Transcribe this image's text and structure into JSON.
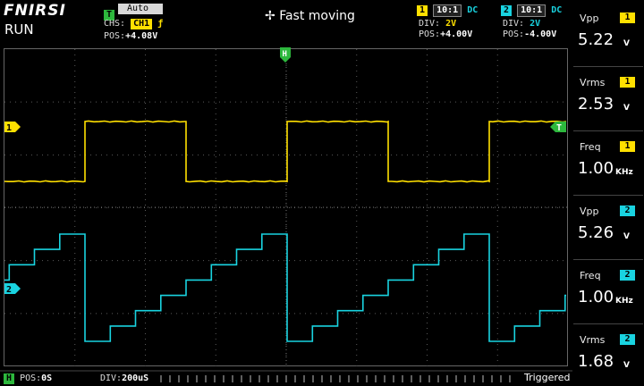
{
  "header": {
    "brand": "FNIRSI",
    "run_state": "RUN",
    "trigger_badge": "T",
    "trigger_mode": "Auto",
    "ch_select_label": "CHS:",
    "ch_select_value": "CH1",
    "edge_symbol": "ƒ",
    "pos_label": "POS:",
    "pos_value": "+4.08V",
    "move_icon": "✢",
    "move_mode": "Fast moving"
  },
  "ch1_settings": {
    "badge": "1",
    "probe": "10:1",
    "coupling": "DC",
    "div_label": "DIV:",
    "div_value": "2V",
    "pos_label": "POS:",
    "pos_value": "+4.00V",
    "color": "#ffe000"
  },
  "ch2_settings": {
    "badge": "2",
    "probe": "10:1",
    "coupling": "DC",
    "div_label": "DIV:",
    "div_value": "2V",
    "pos_label": "POS:",
    "pos_value": "-4.00V",
    "color": "#19d3e0"
  },
  "markers": {
    "ch1": "1",
    "ch2": "2",
    "trigger": "T",
    "horizontal": "H"
  },
  "measurements": [
    {
      "label": "Vpp",
      "channel": "1",
      "value": "5.22",
      "unit": "V"
    },
    {
      "label": "Vrms",
      "channel": "1",
      "value": "2.53",
      "unit": "V"
    },
    {
      "label": "Freq",
      "channel": "1",
      "value": "1.00",
      "unit": "KHz"
    },
    {
      "label": "Vpp",
      "channel": "2",
      "value": "5.26",
      "unit": "V"
    },
    {
      "label": "Freq",
      "channel": "2",
      "value": "1.00",
      "unit": "KHz"
    },
    {
      "label": "Vrms",
      "channel": "2",
      "value": "1.68",
      "unit": "V"
    }
  ],
  "footer": {
    "h_badge": "H",
    "pos_label": "POS:",
    "pos_value": "0S",
    "div_label": "DIV:",
    "div_value": "200uS",
    "status": "Triggered"
  },
  "chart_data": {
    "type": "line",
    "series": [
      {
        "name": "CH1",
        "waveform": "square",
        "vpp": 5.22,
        "freq_khz": 1.0
      },
      {
        "name": "CH2",
        "waveform": "staircase",
        "vpp": 5.26,
        "freq_khz": 1.0,
        "steps": 8
      }
    ]
  }
}
